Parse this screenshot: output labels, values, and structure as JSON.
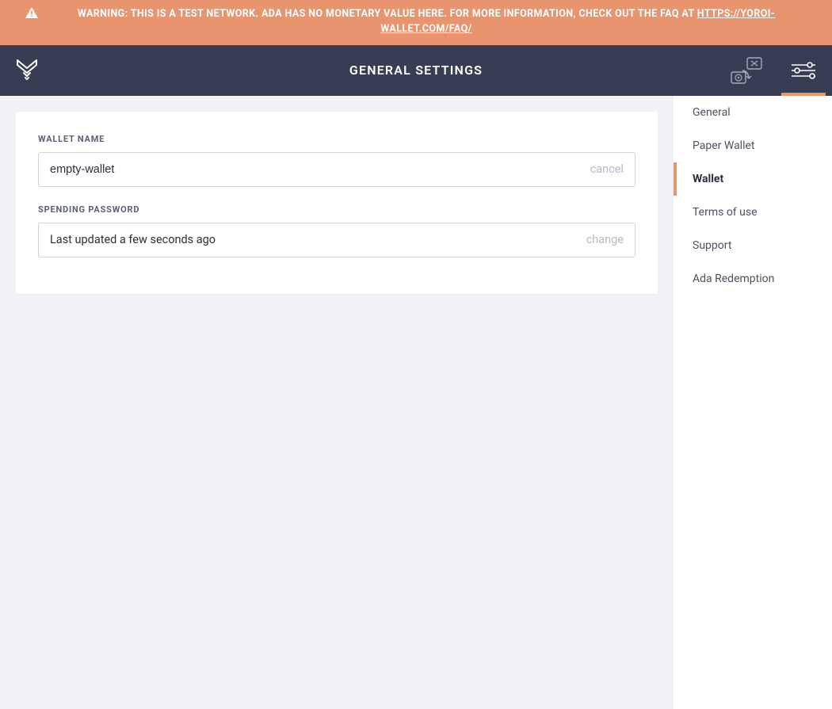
{
  "warning": {
    "text": "WARNING: THIS IS A TEST NETWORK. ADA HAS NO MONETARY VALUE HERE. FOR MORE INFORMATION, CHECK OUT THE FAQ AT ",
    "link_text": "HTTPS://YOROI-WALLET.COM/FAQ/"
  },
  "header": {
    "title": "GENERAL SETTINGS"
  },
  "fields": {
    "wallet_name": {
      "label": "WALLET NAME",
      "value": "empty-wallet",
      "action": "cancel"
    },
    "spending_password": {
      "label": "SPENDING PASSWORD",
      "value": "Last updated a few seconds ago",
      "action": "change"
    }
  },
  "sidebar": {
    "items": [
      {
        "label": "General"
      },
      {
        "label": "Paper Wallet"
      },
      {
        "label": "Wallet"
      },
      {
        "label": "Terms of use"
      },
      {
        "label": "Support"
      },
      {
        "label": "Ada Redemption"
      }
    ],
    "active_index": 2
  },
  "colors": {
    "accent": "#e8946e",
    "dark": "#373d52"
  }
}
